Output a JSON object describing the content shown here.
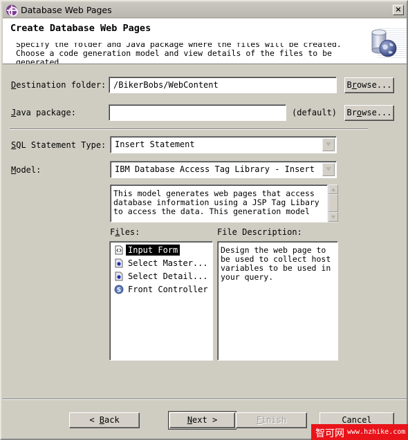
{
  "window": {
    "title": "Database Web Pages",
    "close_label": "×"
  },
  "banner": {
    "title": "Create Database Web Pages",
    "description_line1": "Specify the folder and Java package where the files will be created.",
    "description_line2": "Choose a code generation model and view details of the files to be",
    "description_line3": "generated.",
    "icon": "database-globe-icon"
  },
  "form": {
    "destination_folder": {
      "label_mnemonic": "D",
      "label_rest": "estination folder:",
      "value": "/BikerBobs/WebContent",
      "browse_label_pre": "B",
      "browse_label_mnemonic": "r",
      "browse_label_post": "owse..."
    },
    "java_package": {
      "label_mnemonic": "J",
      "label_rest": "ava package:",
      "value": "",
      "default_hint": "(default)",
      "browse_label_pre": "Br",
      "browse_label_mnemonic": "o",
      "browse_label_post": "wse..."
    },
    "sql_statement_type": {
      "label_mnemonic": "S",
      "label_rest": "QL Statement Type:",
      "selected": "Insert Statement"
    },
    "model": {
      "label_mnemonic": "M",
      "label_rest": "odel:",
      "selected": "IBM Database Access Tag Library - Insert S",
      "description": "This model generates web pages that access\ndatabase information using a JSP Tag Libary\nto access the data. This generation model"
    },
    "files": {
      "label_pre": "F",
      "label_mnemonic": "i",
      "label_post": "les:",
      "items": [
        {
          "label": "Input Form",
          "icon": "html-file-icon",
          "selected": true
        },
        {
          "label": "Select Master...",
          "icon": "jsp-file-icon",
          "selected": false
        },
        {
          "label": "Select Detail...",
          "icon": "jsp-file-icon",
          "selected": false
        },
        {
          "label": "Front Controller",
          "icon": "servlet-icon",
          "selected": false
        }
      ]
    },
    "file_description": {
      "label": "File Description:",
      "text": "Design the web page to\nbe used to collect host\nvariables to be used in\nyour query."
    }
  },
  "buttons": {
    "back_pre": "< ",
    "back_mnemonic": "B",
    "back_post": "ack",
    "next_mnemonic": "N",
    "next_post": "ext >",
    "finish_mnemonic": "F",
    "finish_post": "inish",
    "cancel": "Cancel"
  },
  "watermark": {
    "cn": "智可网",
    "url": "www.hzhike.com"
  },
  "colors": {
    "dialog_bg": "#cfcdc2",
    "selection_bg": "#000000",
    "watermark_bg": "#e8141a"
  }
}
